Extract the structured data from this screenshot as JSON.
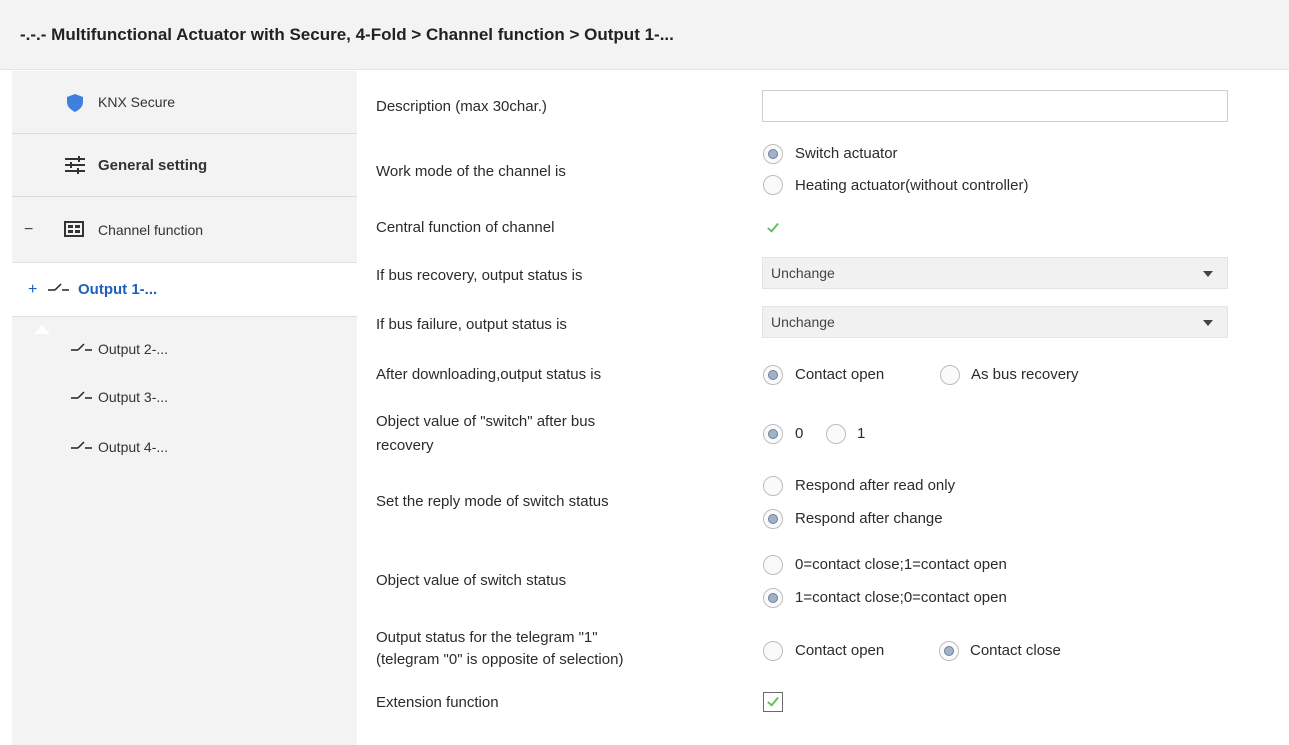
{
  "header": {
    "title": "-.-.- Multifunctional Actuator with Secure, 4-Fold > Channel function > Output 1-..."
  },
  "sidebar": {
    "knx_secure": "KNX Secure",
    "general_setting": "General setting",
    "channel_function": "Channel function",
    "collapse_symbol": "−",
    "expand_symbol": "+",
    "outputs": [
      "Output 1-...",
      "Output 2-...",
      "Output 3-...",
      "Output 4-..."
    ]
  },
  "params": {
    "description": {
      "label": "Description (max 30char.)",
      "value": ""
    },
    "work_mode": {
      "label": "Work mode of the channel is",
      "options": [
        "Switch actuator",
        "Heating actuator(without controller)"
      ],
      "selected": 0
    },
    "central_function": {
      "label": "Central function of channel",
      "checked": true
    },
    "bus_recovery": {
      "label": "If bus recovery, output status is",
      "value": "Unchange"
    },
    "bus_failure": {
      "label": "If bus failure, output status is",
      "value": "Unchange"
    },
    "after_download": {
      "label": "After downloading,output status is",
      "options": [
        "Contact open",
        "As bus recovery"
      ],
      "selected": 0
    },
    "switch_object": {
      "label_line1": "Object value of \"switch\" after bus",
      "label_line2": "recovery",
      "options": [
        "0",
        "1"
      ],
      "selected": 0
    },
    "reply_mode": {
      "label": "Set the reply mode of switch status",
      "options": [
        "Respond after read only",
        "Respond after change"
      ],
      "selected": 1
    },
    "switch_status": {
      "label": "Object value of switch status",
      "options": [
        "0=contact close;1=contact open",
        "1=contact close;0=contact open"
      ],
      "selected": 1
    },
    "telegram": {
      "label_line1": "Output status for the telegram \"1\"",
      "label_line2": " (telegram \"0\" is opposite of selection)",
      "options": [
        "Contact open",
        "Contact close"
      ],
      "selected": 1
    },
    "extension": {
      "label": "Extension function",
      "checked": true
    }
  },
  "colors": {
    "accent": "#1f5fbf",
    "shield": "#3f7fe0",
    "sidebar_bg": "#f3f3f3",
    "check": "#6abf6a"
  }
}
